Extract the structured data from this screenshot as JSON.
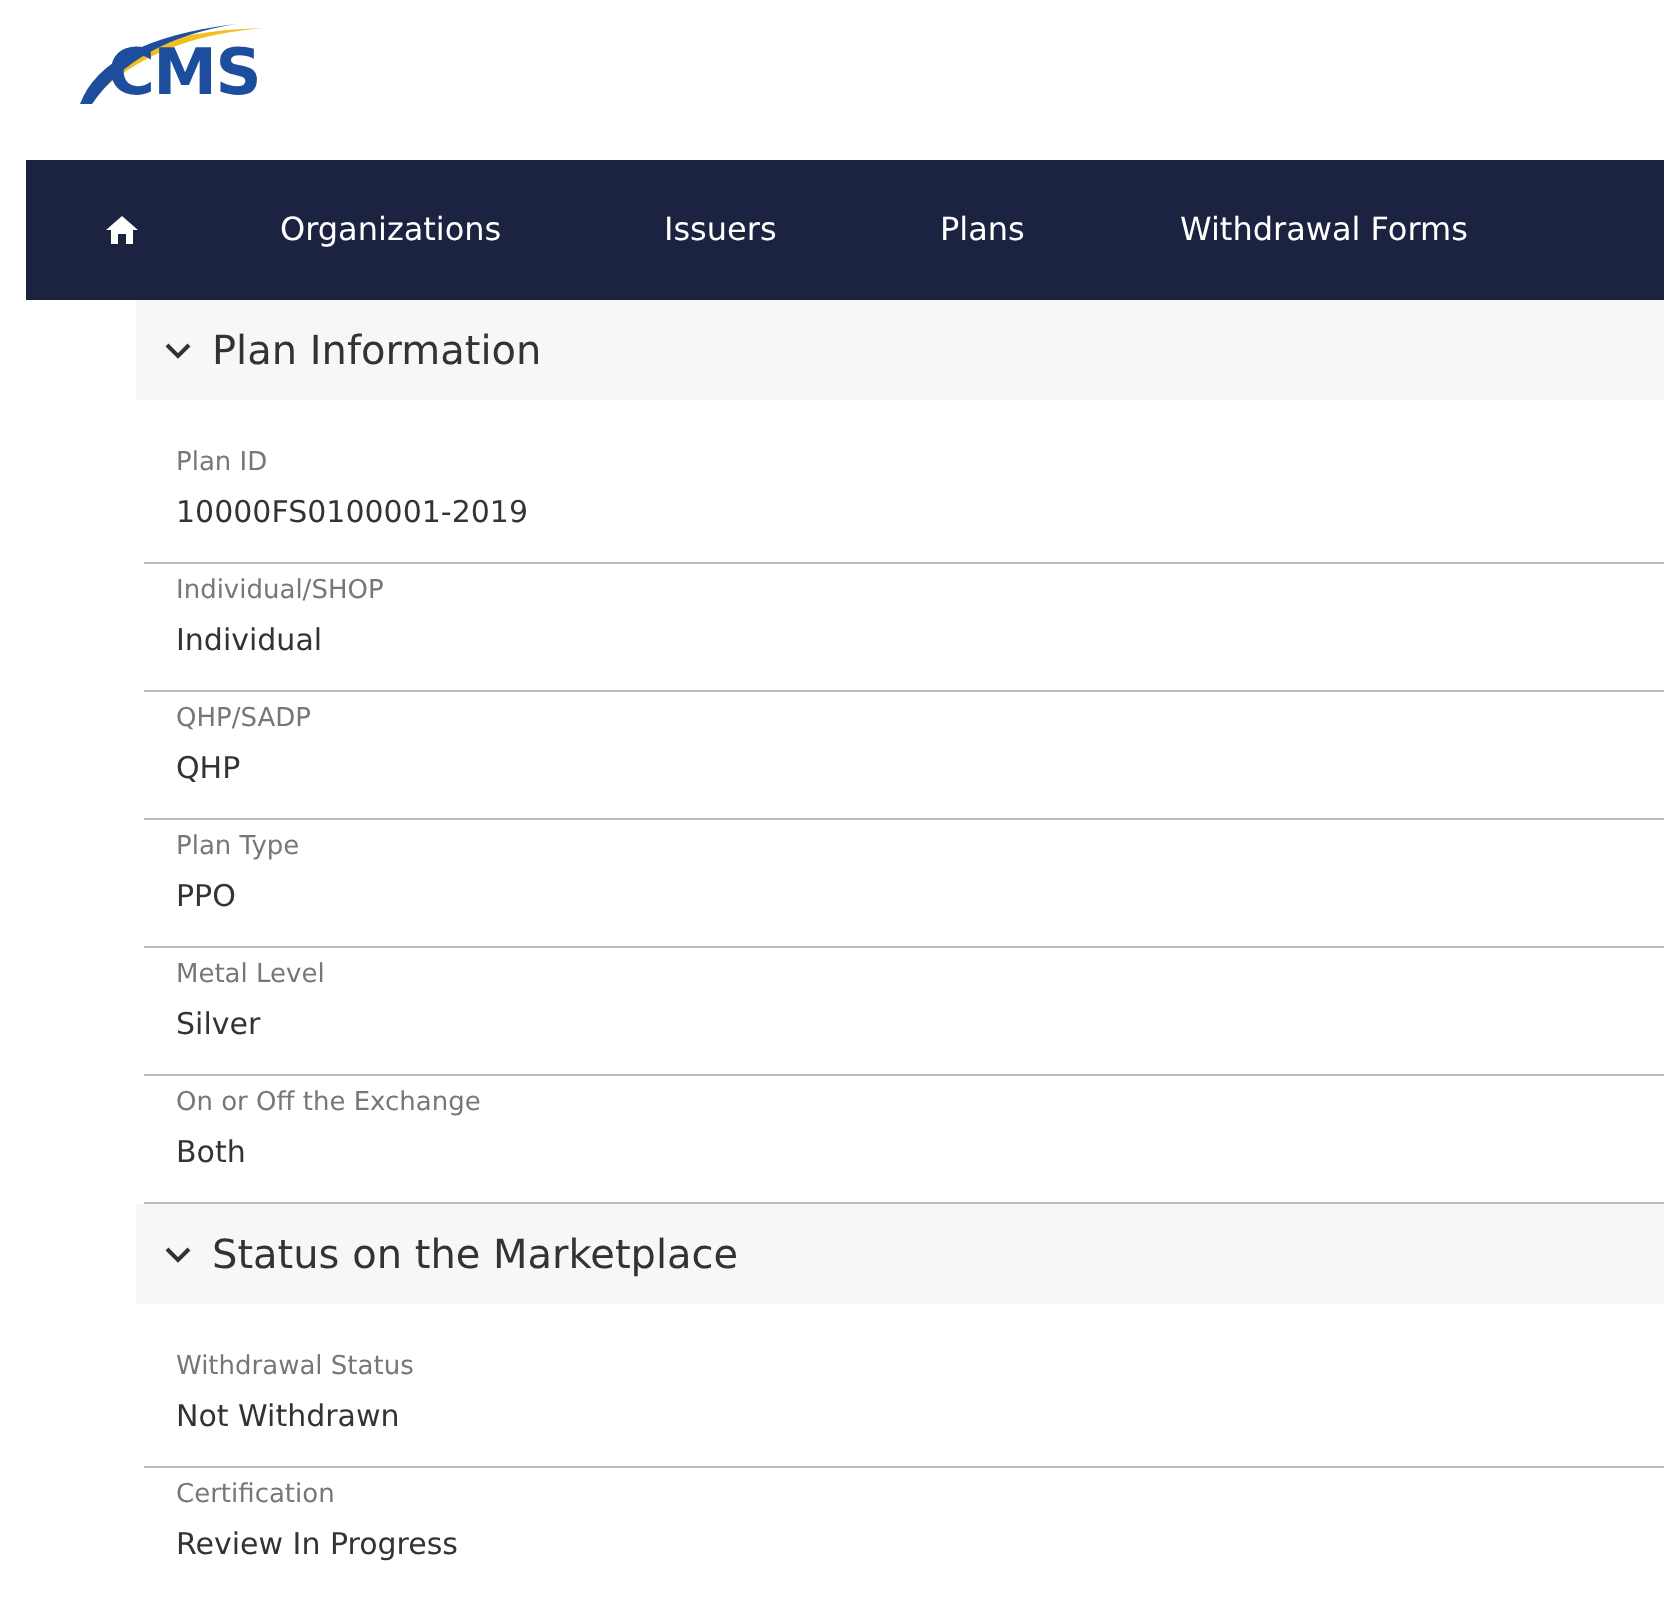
{
  "logo": {
    "text": "CMS"
  },
  "nav": {
    "items": [
      {
        "kind": "home"
      },
      {
        "kind": "link",
        "label": "Organizations"
      },
      {
        "kind": "link",
        "label": "Issuers"
      },
      {
        "kind": "link",
        "label": "Plans"
      },
      {
        "kind": "link",
        "label": "Withdrawal Forms"
      }
    ]
  },
  "sections": [
    {
      "title": "Plan Information",
      "expanded": true,
      "fields": [
        {
          "label": "Plan ID",
          "value": "10000FS0100001-2019"
        },
        {
          "label": "Individual/SHOP",
          "value": "Individual"
        },
        {
          "label": "QHP/SADP",
          "value": "QHP"
        },
        {
          "label": "Plan Type",
          "value": "PPO"
        },
        {
          "label": "Metal Level",
          "value": "Silver"
        },
        {
          "label": "On or Off the Exchange",
          "value": "Both"
        }
      ]
    },
    {
      "title": "Status on the Marketplace",
      "expanded": true,
      "fields": [
        {
          "label": "Withdrawal Status",
          "value": "Not Withdrawn"
        },
        {
          "label": "Certification",
          "value": "Review In Progress"
        }
      ]
    }
  ]
}
